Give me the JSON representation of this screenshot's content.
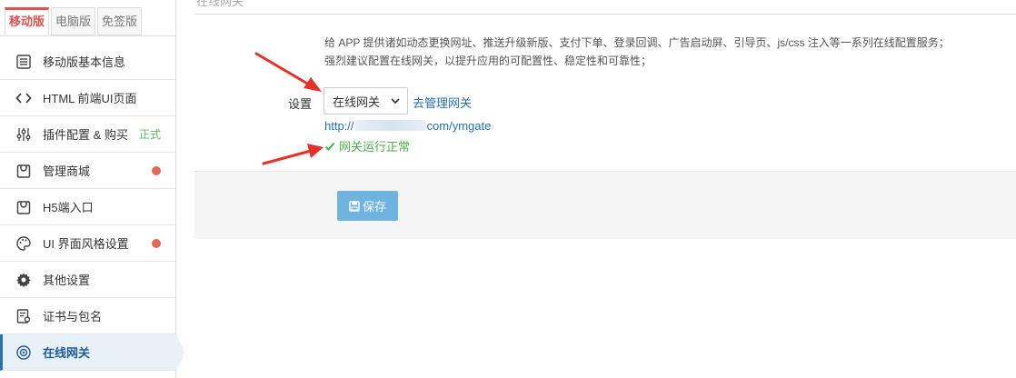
{
  "tabs": [
    {
      "label": "移动版",
      "active": true
    },
    {
      "label": "电脑版",
      "active": false
    },
    {
      "label": "免签版",
      "active": false
    }
  ],
  "menu": [
    {
      "label": "移动版基本信息",
      "icon": "list-icon"
    },
    {
      "label": "HTML 前端UI页面",
      "icon": "code-icon"
    },
    {
      "label": "插件配置 & 购买",
      "icon": "sliders-icon",
      "badge": "正式"
    },
    {
      "label": "管理商城",
      "icon": "bag-icon",
      "dot": true
    },
    {
      "label": "H5端入口",
      "icon": "bag-icon"
    },
    {
      "label": "UI 界面风格设置",
      "icon": "palette-icon",
      "dot": true
    },
    {
      "label": "其他设置",
      "icon": "gear-icon"
    },
    {
      "label": "证书与包名",
      "icon": "certificate-icon"
    },
    {
      "label": "在线网关",
      "icon": "gateway-icon",
      "active": true
    }
  ],
  "header": {
    "title": "在线网关"
  },
  "main": {
    "description_line1": "给 APP 提供诸如动态更换网址、推送升级新版、支付下单、登录回调、广告启动屏、引导页、js/css 注入等一系列在线配置服务；",
    "description_line2": "强烈建议配置在线网关，以提升应用的可配置性、稳定性和可靠性；",
    "setting_label": "设置",
    "select_value": "在线网关",
    "manage_link": "去管理网关",
    "url_prefix": "http://",
    "url_suffix": "com/ymgate",
    "status_text": "网关运行正常",
    "save_label": "保存"
  },
  "colors": {
    "accent_red": "#d9534f",
    "link_blue": "#2a6fb0",
    "success_green": "#4cae4c",
    "save_button": "#6fb3e0",
    "annotation_red": "#e8302b"
  }
}
